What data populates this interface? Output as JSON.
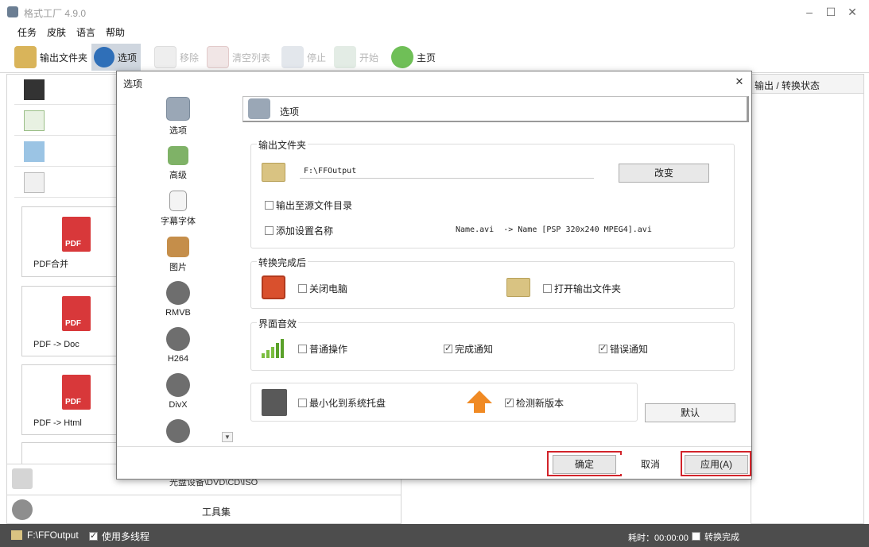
{
  "app": {
    "title": "格式工厂 4.9.0",
    "window_controls": [
      "–",
      "☐",
      "✕"
    ]
  },
  "menu": {
    "items": [
      "任务",
      "皮肤",
      "语言",
      "帮助"
    ]
  },
  "toolbar": {
    "output_folder": "输出文件夹",
    "options": "选项",
    "remove": "移除",
    "clear_list": "清空列表",
    "stop": "停止",
    "start": "开始",
    "home": "主页"
  },
  "left": {
    "cards": [
      {
        "label": "PDF合并",
        "badge": "PDF"
      },
      {
        "label": "PDF -> Doc",
        "badge": "PDF"
      },
      {
        "label": "PDF -> Html",
        "badge": "PDF"
      }
    ],
    "category_bottom": {
      "disc": "光盘设备\\DVD\\CD\\ISO",
      "tools": "工具集"
    }
  },
  "right": {
    "header": "输出 / 转换状态"
  },
  "status": {
    "output_path": "F:\\FFOutput",
    "multithread_label": "使用多线程",
    "elapsed": "耗时：00:00:00",
    "after_convert": "转换完成"
  },
  "dialog": {
    "title": "选项",
    "close": "✕",
    "nav": [
      "选项",
      "高级",
      "字幕字体",
      "图片",
      "RMVB",
      "H264",
      "DivX"
    ],
    "header_label": "选项",
    "output_folder_group": {
      "label": "输出文件夹",
      "path": "F:\\FFOutput",
      "change_button": "改变",
      "output_to_source": "输出至源文件目录",
      "add_setting_name": "添加设置名称",
      "example": "Name.avi  -> Name [PSP 320x240 MPEG4].avi"
    },
    "after_convert_group": {
      "label": "转换完成后",
      "shutdown": "关闭电脑",
      "open_folder": "打开输出文件夹"
    },
    "sound_group": {
      "label": "界面音效",
      "normal": "普通操作",
      "done": "完成通知",
      "error": "错误通知"
    },
    "misc": {
      "minimize_tray": "最小化到系统托盘",
      "check_update": "检测新版本",
      "default_button": "默认"
    },
    "buttons": {
      "ok": "确定",
      "cancel": "取消",
      "apply": "应用(A)"
    }
  },
  "colors": {
    "highlight_red": "#d2232a",
    "statusbar": "#4d4d4d",
    "pdf_red": "#d8383a"
  }
}
